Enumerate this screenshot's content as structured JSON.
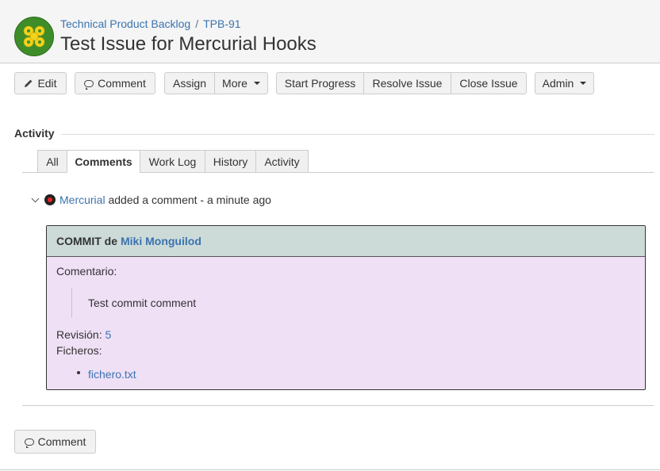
{
  "header": {
    "project_name": "Technical Product Backlog",
    "separator": "/",
    "issue_key": "TPB-91",
    "title": "Test Issue for Mercurial Hooks",
    "avatar_icon": "gears-icon"
  },
  "toolbar": {
    "edit": "Edit",
    "comment": "Comment",
    "assign": "Assign",
    "more": "More",
    "start_progress": "Start Progress",
    "resolve_issue": "Resolve Issue",
    "close_issue": "Close Issue",
    "admin": "Admin"
  },
  "activity": {
    "heading": "Activity",
    "tabs": [
      {
        "label": "All",
        "active": false
      },
      {
        "label": "Comments",
        "active": true
      },
      {
        "label": "Work Log",
        "active": false
      },
      {
        "label": "History",
        "active": false
      },
      {
        "label": "Activity",
        "active": false
      }
    ],
    "entry": {
      "author": "Mercurial",
      "action": " added a comment - ",
      "time": "a minute ago",
      "commit": {
        "header_prefix": "COMMIT de",
        "author": "Miki Monguilod",
        "comment_label": "Comentario:",
        "comment_text": "Test commit comment",
        "revision_label": "Revisión:",
        "revision_value": "5",
        "files_label": "Ficheros:",
        "files": [
          "fichero.txt"
        ]
      }
    }
  },
  "footer": {
    "comment_button": "Comment"
  },
  "colors": {
    "link": "#3b73af",
    "commit_header_bg": "#cddbd8",
    "commit_body_bg": "#efe0f6",
    "header_bg": "#f5f5f5"
  }
}
